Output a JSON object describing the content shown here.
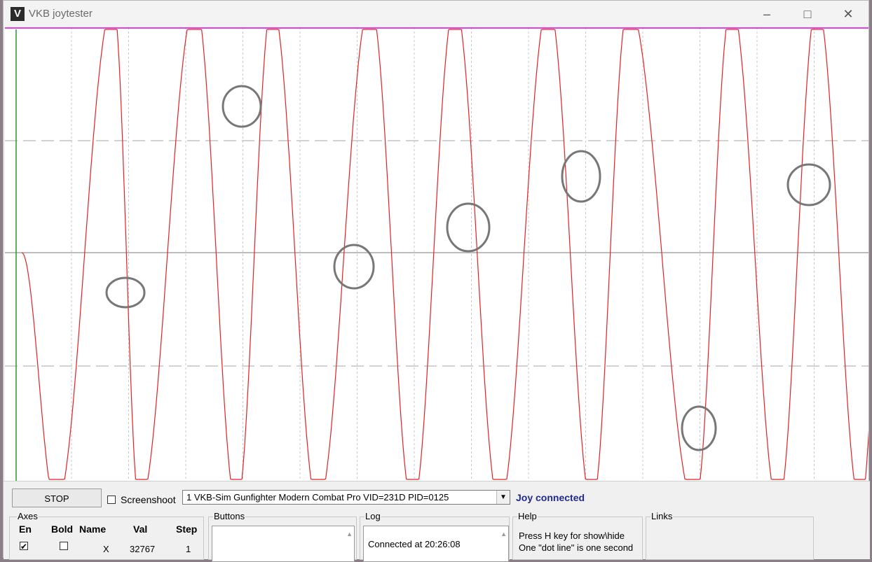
{
  "window": {
    "title": "VKB joytester"
  },
  "titlebar": {
    "minimize_icon": "minimize-icon",
    "maximize_icon": "maximize-icon",
    "close_icon": "close-icon"
  },
  "controls": {
    "stop_label": "STOP",
    "screenshoot_label": "Screenshoot",
    "screenshoot_checked": false,
    "device_selected": "1  VKB-Sim Gunfighter Modern Combat Pro  VID=231D PID=0125",
    "joy_status": "Joy connected",
    "status_color": "#1f2a8c"
  },
  "axes_panel": {
    "title": "Axes",
    "headers": {
      "en": "En",
      "bold": "Bold",
      "name": "Name",
      "val": "Val",
      "step": "Step"
    },
    "rows": [
      {
        "en": true,
        "bold": false,
        "name": "X",
        "val": "32767",
        "step": "1"
      }
    ]
  },
  "buttons_panel": {
    "title": "Buttons"
  },
  "log_panel": {
    "title": "Log",
    "lines": [
      "Connected at 20:26:08"
    ]
  },
  "help_panel": {
    "title": "Help",
    "line1": "Press H key for show\\hide",
    "line2": "One \"dot line\" is one second"
  },
  "links_panel": {
    "title": "Links"
  },
  "plot": {
    "trace_color": "#e32222",
    "top_line_color": "#e000e0",
    "left_axis_color": "#2a9a2a",
    "peak_times": [
      0.85,
      1.57,
      2.24,
      3.1,
      3.84,
      4.66,
      5.36,
      6.26,
      7.01,
      7.68
    ],
    "trough_times": [
      0.35,
      1.08,
      1.93,
      2.64,
      3.47,
      4.23,
      5.04,
      5.94,
      6.67,
      7.39
    ],
    "start_time": 0.05,
    "end_time": 7.61,
    "annotation_circles": 9
  }
}
